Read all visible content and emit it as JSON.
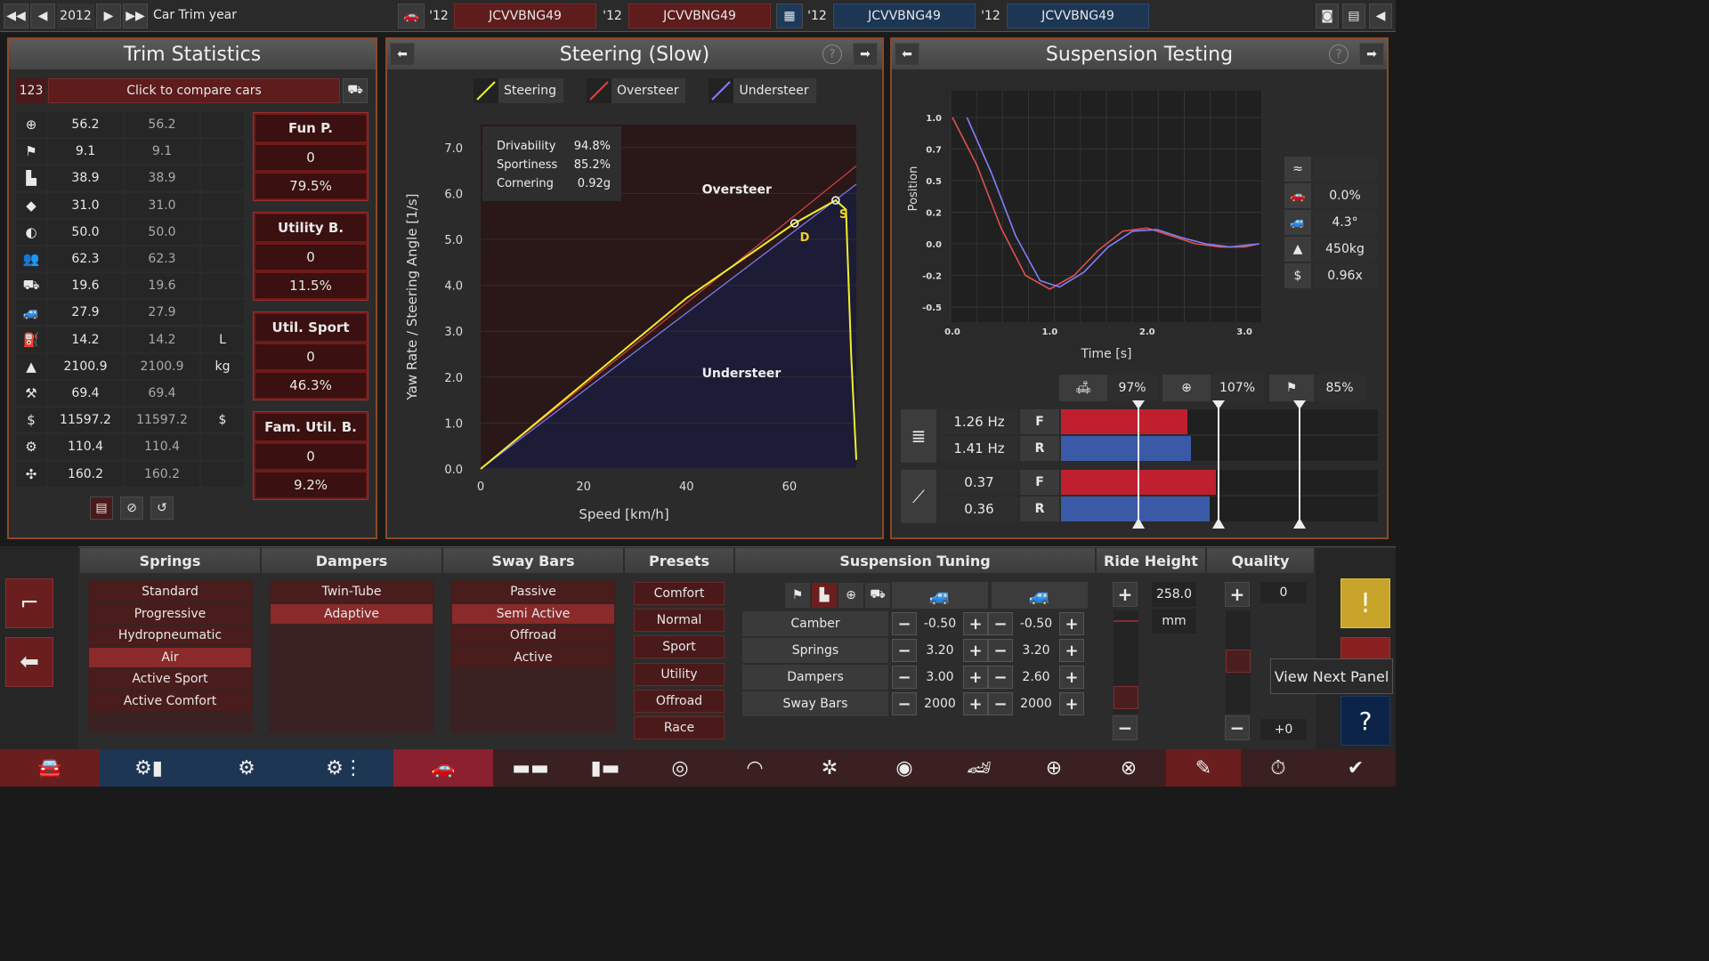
{
  "top_bar": {
    "year": "2012",
    "title": "Car Trim year",
    "compare": [
      {
        "year": "'12",
        "code": "JCVVBNG49"
      },
      {
        "year": "'12",
        "code": "JCVVBNG49"
      },
      {
        "year": "'12",
        "code": "JCVVBNG49"
      },
      {
        "year": "'12",
        "code": "JCVVBNG49"
      }
    ]
  },
  "trim_stats": {
    "title": "Trim Statistics",
    "compare_id": "123",
    "compare_label": "Click to compare cars",
    "rows": [
      {
        "icon": "steering-wheel-icon",
        "a": "56.2",
        "b": "56.2",
        "unit": ""
      },
      {
        "icon": "race-flag-icon",
        "a": "9.1",
        "b": "9.1",
        "unit": ""
      },
      {
        "icon": "seat-icon",
        "a": "38.9",
        "b": "38.9",
        "unit": ""
      },
      {
        "icon": "diamond-icon",
        "a": "31.0",
        "b": "31.0",
        "unit": ""
      },
      {
        "icon": "safety-icon",
        "a": "50.0",
        "b": "50.0",
        "unit": ""
      },
      {
        "icon": "passengers-icon",
        "a": "62.3",
        "b": "62.3",
        "unit": ""
      },
      {
        "icon": "utility-car-icon",
        "a": "19.6",
        "b": "19.6",
        "unit": ""
      },
      {
        "icon": "offroad-car-icon",
        "a": "27.9",
        "b": "27.9",
        "unit": ""
      },
      {
        "icon": "fuel-icon",
        "a": "14.2",
        "b": "14.2",
        "unit": "L"
      },
      {
        "icon": "weight-icon",
        "a": "2100.9",
        "b": "2100.9",
        "unit": "kg"
      },
      {
        "icon": "reliability-icon",
        "a": "69.4",
        "b": "69.4",
        "unit": ""
      },
      {
        "icon": "cost-icon",
        "a": "11597.2",
        "b": "11597.2",
        "unit": "$"
      },
      {
        "icon": "production-icon",
        "a": "110.4",
        "b": "110.4",
        "unit": ""
      },
      {
        "icon": "engineering-icon",
        "a": "160.2",
        "b": "160.2",
        "unit": ""
      }
    ],
    "scores": [
      {
        "label": "Fun P.",
        "rank": "0",
        "value": "79.5%"
      },
      {
        "label": "Utility B.",
        "rank": "0",
        "value": "11.5%"
      },
      {
        "label": "Util. Sport",
        "rank": "0",
        "value": "46.3%"
      },
      {
        "label": "Fam. Util. B.",
        "rank": "0",
        "value": "9.2%"
      }
    ]
  },
  "steering": {
    "title": "Steering (Slow)",
    "legend": [
      "Steering",
      "Oversteer",
      "Understeer"
    ],
    "stats": [
      {
        "label": "Drivability",
        "value": "94.8%"
      },
      {
        "label": "Sportiness",
        "value": "85.2%"
      },
      {
        "label": "Cornering",
        "value": "0.92g"
      }
    ],
    "region_over": "Oversteer",
    "region_under": "Understeer",
    "marker_d": "D",
    "marker_s": "S"
  },
  "suspension_test": {
    "title": "Suspension Testing",
    "side_values": [
      "0.0%",
      "4.3°",
      "450kg",
      "0.96x"
    ],
    "perc": [
      "97%",
      "107%",
      "85%"
    ],
    "freq": [
      {
        "value": "1.26 Hz",
        "axle": "F"
      },
      {
        "value": "1.41 Hz",
        "axle": "R"
      }
    ],
    "damp": [
      {
        "value": "0.37",
        "axle": "F"
      },
      {
        "value": "0.36",
        "axle": "R"
      }
    ]
  },
  "chart_data": [
    {
      "type": "line",
      "title": "",
      "xlabel": "Speed [km/h]",
      "ylabel": "Yaw Rate / Steering Angle [1/s]",
      "xlim": [
        0,
        73
      ],
      "ylim": [
        0,
        7.5
      ],
      "x_ticks": [
        "0",
        "20",
        "40",
        "60"
      ],
      "y_ticks": [
        "0.0",
        "1.0",
        "2.0",
        "3.0",
        "4.0",
        "5.0",
        "6.0",
        "7.0"
      ],
      "series": [
        {
          "name": "Steering",
          "color": "#f0f028",
          "x": [
            0,
            20,
            40,
            61,
            69,
            71,
            72,
            73
          ],
          "y": [
            0,
            1.86,
            3.72,
            5.35,
            5.85,
            5.65,
            2.5,
            0.2
          ]
        },
        {
          "name": "Oversteer",
          "color": "#e04040",
          "x": [
            0,
            73
          ],
          "y": [
            0,
            6.6
          ]
        },
        {
          "name": "Understeer",
          "color": "#8080ff",
          "x": [
            0,
            73
          ],
          "y": [
            0,
            6.2
          ]
        }
      ]
    },
    {
      "type": "line",
      "title": "",
      "xlabel": "Time [s]",
      "ylabel": "Position",
      "xlim": [
        0,
        3.2
      ],
      "x_ticks": [
        "0.0",
        "1.0",
        "2.0",
        "3.0"
      ],
      "y_ticks": [
        "1.0",
        "0.7",
        "0.5",
        "0.2",
        "0.0",
        "-0.2",
        "-0.5"
      ],
      "series": [
        {
          "name": "front",
          "color": "#e05050",
          "x": [
            0,
            0.25,
            0.5,
            0.75,
            1.0,
            1.25,
            1.5,
            1.75,
            2.0,
            2.25,
            2.5,
            2.75,
            3.0,
            3.15
          ],
          "y": [
            1.0,
            0.6,
            0.1,
            -0.2,
            -0.33,
            -0.2,
            -0.04,
            0.08,
            0.1,
            0.05,
            0.0,
            -0.02,
            -0.02,
            0.0
          ]
        },
        {
          "name": "rear",
          "color": "#8080ff",
          "x": [
            0.15,
            0.4,
            0.65,
            0.9,
            1.1,
            1.35,
            1.6,
            1.85,
            2.1,
            2.35,
            2.6,
            2.85,
            3.15
          ],
          "y": [
            1.0,
            0.55,
            0.05,
            -0.25,
            -0.31,
            -0.18,
            -0.02,
            0.08,
            0.09,
            0.04,
            0.0,
            -0.02,
            0.0
          ]
        }
      ]
    }
  ],
  "lower": {
    "springs": {
      "title": "Springs",
      "items": [
        "Standard",
        "Progressive",
        "Hydropneumatic",
        "Air",
        "Active Sport",
        "Active Comfort"
      ],
      "selected": 3
    },
    "dampers": {
      "title": "Dampers",
      "items": [
        "Twin-Tube",
        "Adaptive"
      ],
      "selected": 1
    },
    "sway": {
      "title": "Sway Bars",
      "items": [
        "Passive",
        "Semi Active",
        "Offroad",
        "Active"
      ],
      "selected": 1
    },
    "presets": {
      "title": "Presets",
      "items": [
        "Comfort",
        "Normal",
        "Sport",
        "Utility",
        "Offroad",
        "Race"
      ]
    },
    "tuning": {
      "title": "Suspension Tuning",
      "rows": [
        {
          "label": "Camber",
          "f": "-0.50",
          "r": "-0.50"
        },
        {
          "label": "Springs",
          "f": "3.20",
          "r": "3.20"
        },
        {
          "label": "Dampers",
          "f": "3.00",
          "r": "2.60"
        },
        {
          "label": "Sway Bars",
          "f": "2000",
          "r": "2000"
        }
      ]
    },
    "ride": {
      "title": "Ride Height",
      "value": "258.0",
      "unit": "mm"
    },
    "quality": {
      "title": "Quality",
      "value": "0",
      "delta": "+0"
    },
    "tooltip": "View Next Panel"
  },
  "colors": {
    "accent": "#8a4a28",
    "red": "#c0202e",
    "blue": "#3a5aa8",
    "yellow": "#f0f028"
  }
}
